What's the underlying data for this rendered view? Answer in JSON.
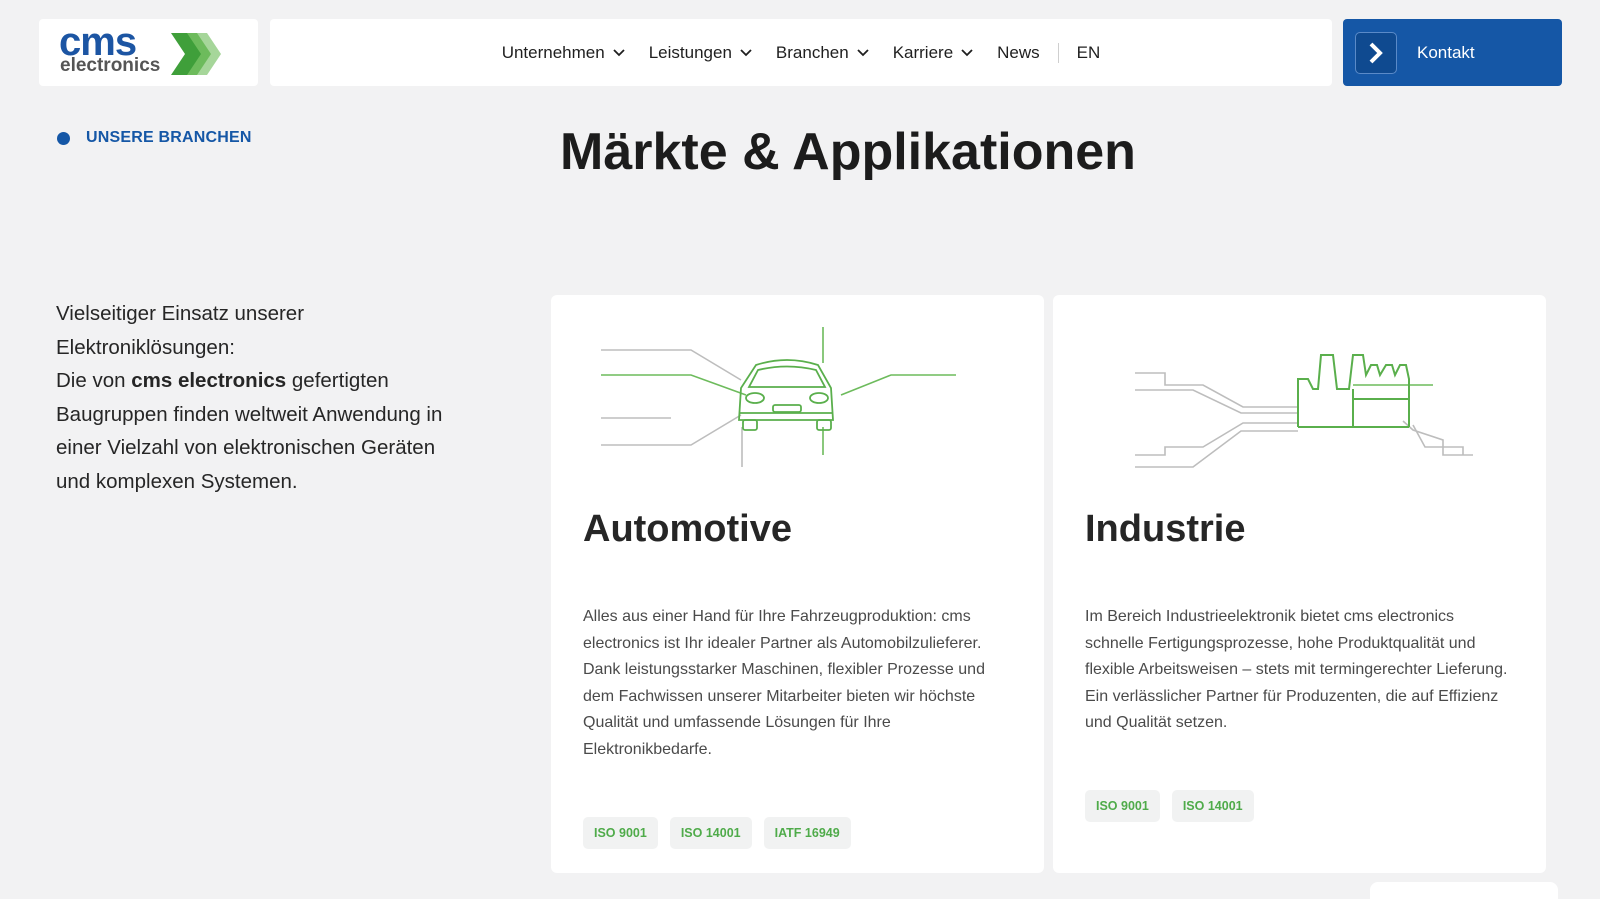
{
  "header": {
    "logo": {
      "primary": "cms",
      "secondary": "electronics"
    },
    "nav": [
      {
        "label": "Unternehmen",
        "has_dropdown": true
      },
      {
        "label": "Leistungen",
        "has_dropdown": true
      },
      {
        "label": "Branchen",
        "has_dropdown": true
      },
      {
        "label": "Karriere",
        "has_dropdown": true
      },
      {
        "label": "News",
        "has_dropdown": false
      }
    ],
    "language": "EN",
    "contact_label": "Kontakt"
  },
  "section": {
    "eyebrow": "UNSERE BRANCHEN",
    "title": "Märkte & Applikationen"
  },
  "intro": {
    "line1": "Vielseitiger Einsatz unserer Elektroniklösungen:",
    "pre": "Die von ",
    "bold": "cms electronics",
    "post": " gefertigten Baugruppen finden weltweit Anwendung in einer Vielzahl von elektronischen Geräten und komplexen Systemen."
  },
  "cards": [
    {
      "title": "Automotive",
      "icon": "car-icon",
      "text": "Alles aus einer Hand für Ihre Fahrzeugproduktion: cms electronics ist Ihr idealer Partner als Automobilzulieferer. Dank leistungsstarker Maschinen, flexibler Prozesse und dem Fachwissen unserer Mitarbeiter bieten wir höchste Qualität und umfassende Lösungen für Ihre Elektronikbedarfe.",
      "badges": [
        "ISO 9001",
        "ISO 14001",
        "IATF 16949"
      ]
    },
    {
      "title": "Industrie",
      "icon": "factory-icon",
      "text": "Im Bereich Industrieelektronik bietet cms electronics schnelle Fertigungsprozesse, hohe Produktqualität und flexible Arbeitsweisen – stets mit termingerechter Lieferung. Ein verlässlicher Partner für Produzenten, die auf Effizienz und Qualität setzen.",
      "badges": [
        "ISO 9001",
        "ISO 14001"
      ]
    }
  ],
  "colors": {
    "brand_blue": "#1557a6",
    "brand_green": "#4fab4a",
    "background": "#f2f2f3"
  }
}
